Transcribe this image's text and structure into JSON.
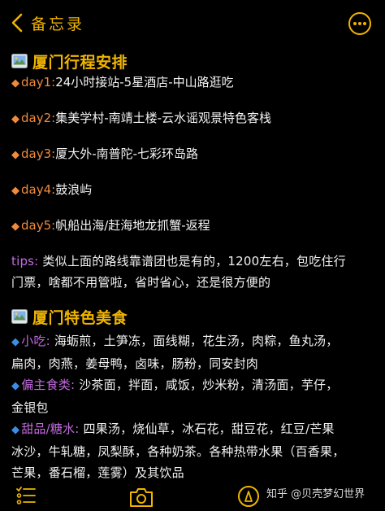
{
  "header": {
    "back_label": "备忘录"
  },
  "itinerary": {
    "title": "厦门行程安排",
    "days": [
      {
        "label": "day1:",
        "text": "24小时接站-5星酒店-中山路逛吃"
      },
      {
        "label": "day2:",
        "text": "集美学村-南靖土楼-云水谣观景特色客栈"
      },
      {
        "label": "day3:",
        "text": "厦大外-南普陀-七彩环岛路"
      },
      {
        "label": "day4:",
        "text": "鼓浪屿"
      },
      {
        "label": "day5:",
        "text": "帆船出海/赶海地龙抓蟹-返程"
      }
    ],
    "tips_label": "tips:",
    "tips_line1": "类似上面的路线靠谱团也是有的，1200左右，包吃住行",
    "tips_line2": "门票，啥都不用管啦，省时省心，还是很方便的"
  },
  "food": {
    "title": "厦门特色美食",
    "snacks_label": "小吃:",
    "snacks_line1": "海蛎煎，土笋冻，面线糊，花生汤，肉粽，鱼丸汤，",
    "snacks_line2": "扁肉，肉燕，姜母鸭，卤味，肠粉，同安封肉",
    "staple_label": "偏主食类:",
    "staple_line1": "沙茶面，拌面，咸饭，炒米粉，清汤面，芋仔，",
    "staple_line2": "金银包",
    "dessert_label": "甜品/糖水:",
    "dessert_line1": "四果汤，烧仙草，冰石花，甜豆花，红豆/芒果",
    "dessert_line2": "冰沙，牛轧糖，凤梨酥，各种奶茶。各种热带水果（百香果，",
    "dessert_line3": "芒果，番石榴，莲雾）及其饮品"
  },
  "watermark": "知乎 @贝壳梦幻世界",
  "colors": {
    "accent": "#f0b400",
    "orange": "#f08a3c",
    "purple": "#c46be0",
    "blue": "#3a8ee6",
    "background": "#000000"
  },
  "icons": [
    "chevron-left-icon",
    "more-icon",
    "picture-icon",
    "checklist-icon",
    "camera-icon",
    "pen-icon"
  ]
}
